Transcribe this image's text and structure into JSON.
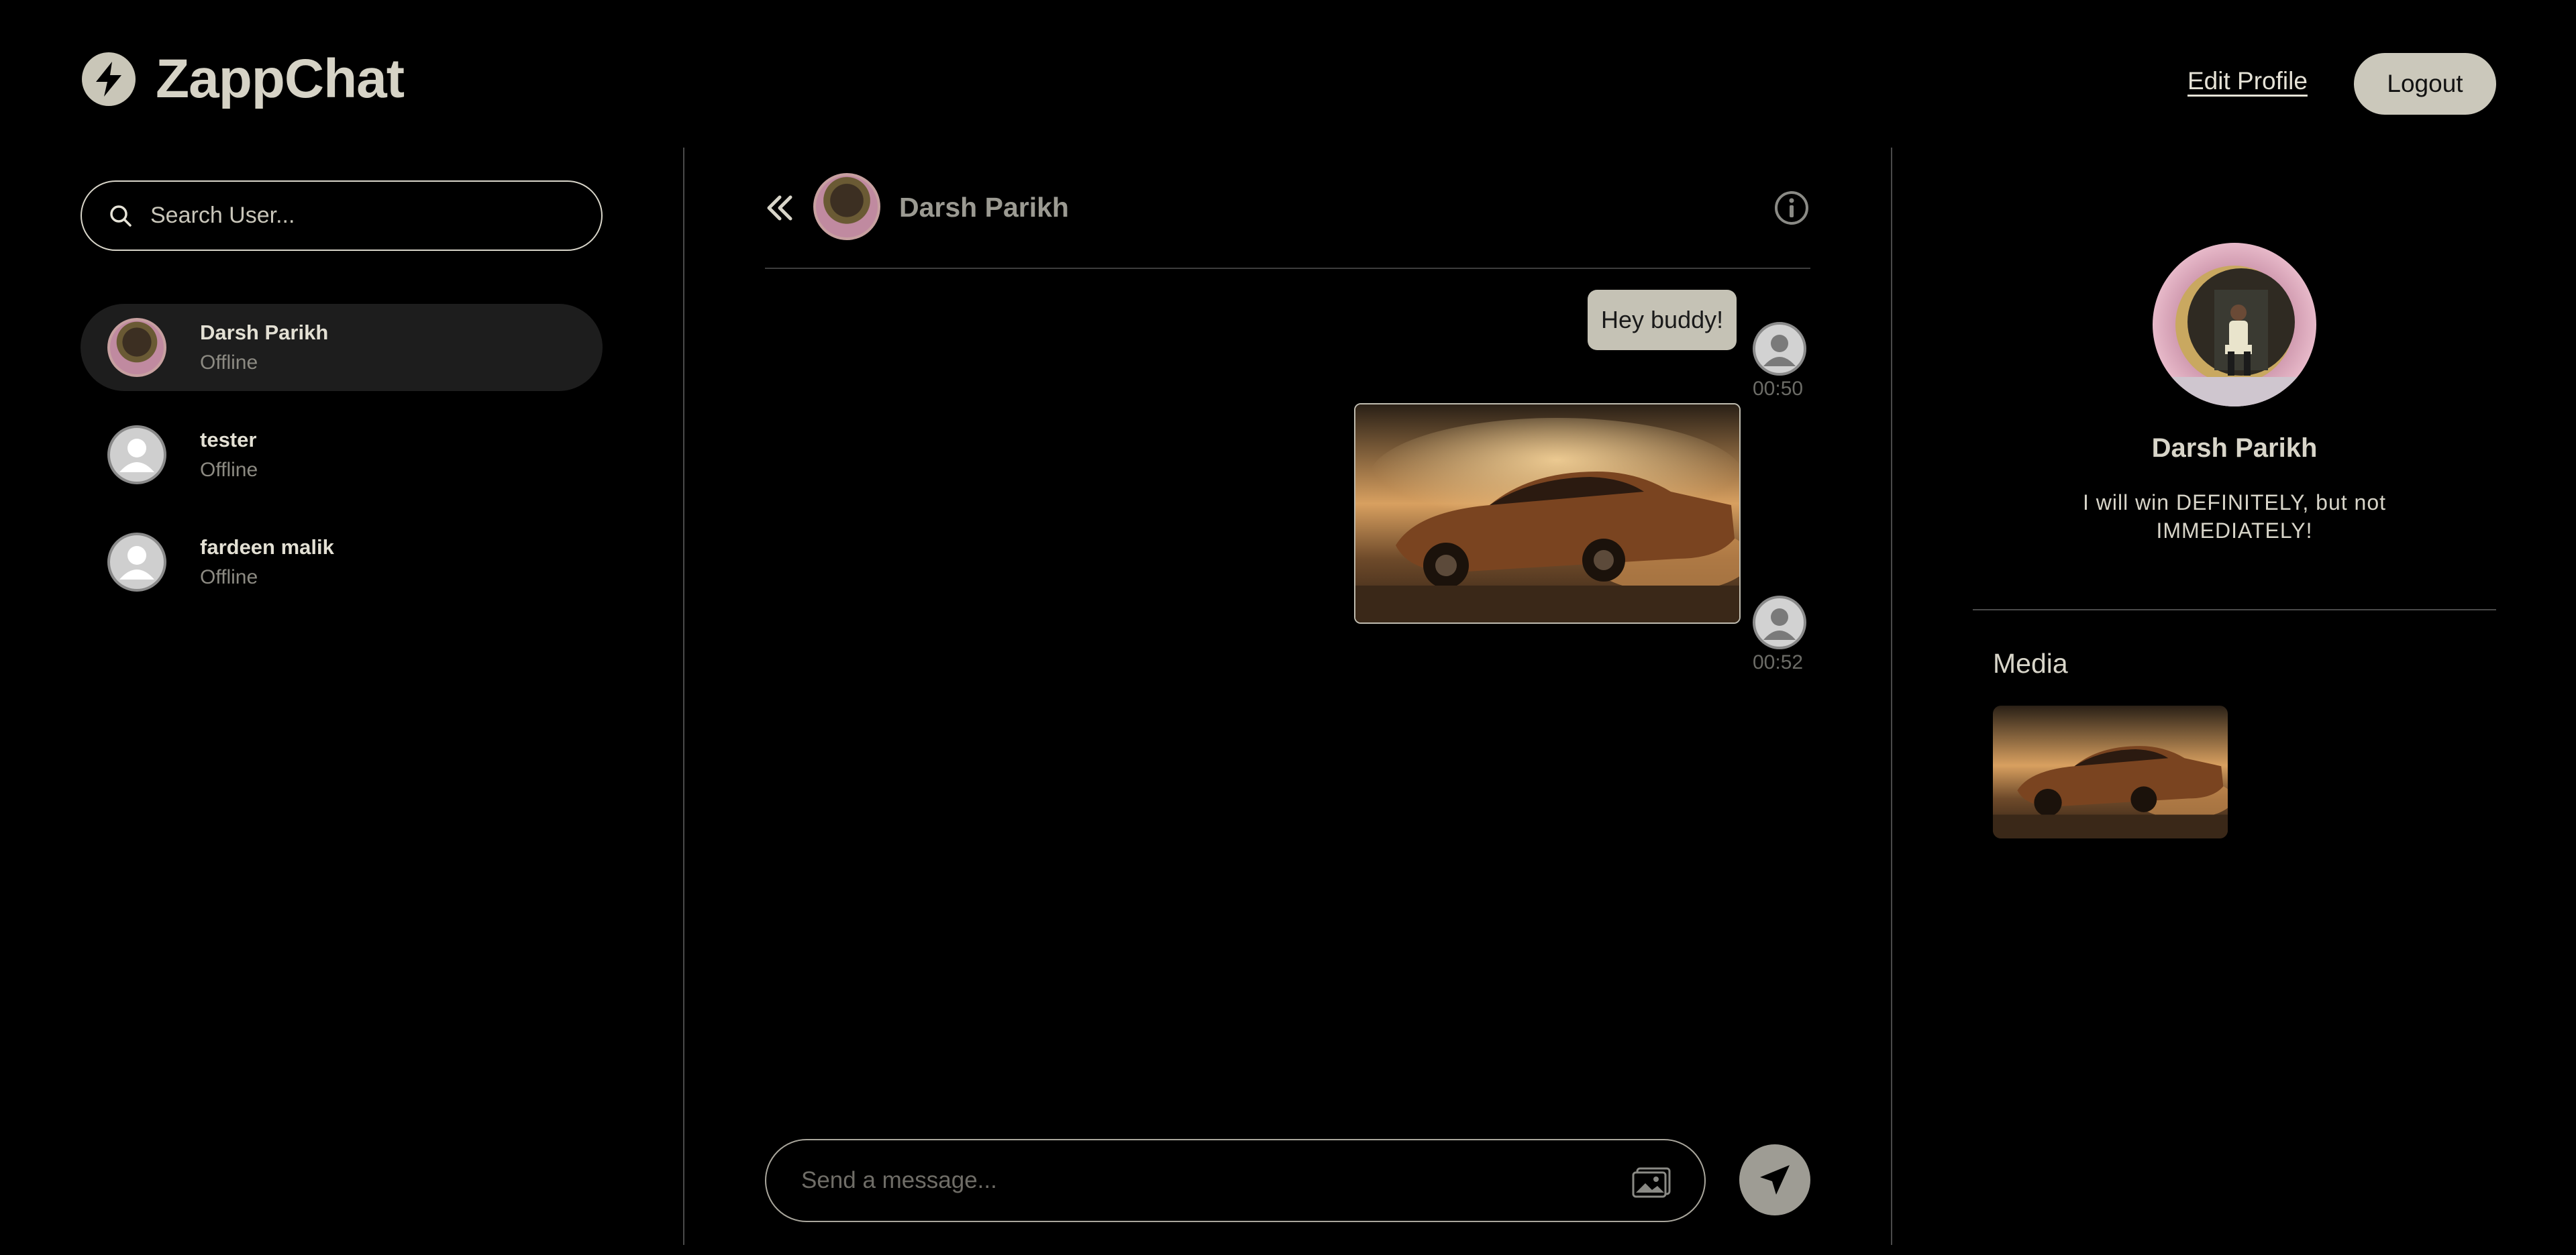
{
  "app": {
    "name": "ZappChat"
  },
  "header": {
    "edit_profile": "Edit Profile",
    "logout": "Logout"
  },
  "sidebar": {
    "search_placeholder": "Search User...",
    "users": [
      {
        "name": "Darsh Parikh",
        "status": "Offline",
        "active": true
      },
      {
        "name": "tester",
        "status": "Offline",
        "active": false
      },
      {
        "name": "fardeen malik",
        "status": "Offline",
        "active": false
      }
    ]
  },
  "chat": {
    "contact_name": "Darsh Parikh",
    "messages": [
      {
        "type": "text",
        "text": "Hey buddy!",
        "time": "00:50"
      },
      {
        "type": "image",
        "time": "00:52"
      }
    ],
    "composer_placeholder": "Send a message..."
  },
  "profile": {
    "name": "Darsh Parikh",
    "bio": "I will win DEFINITELY, but not IMMEDIATELY!",
    "media_heading": "Media"
  },
  "colors": {
    "background": "#000000",
    "accent": "#cbc8bb",
    "active_row": "#1d1d1d",
    "muted_text": "#8c8a82"
  }
}
